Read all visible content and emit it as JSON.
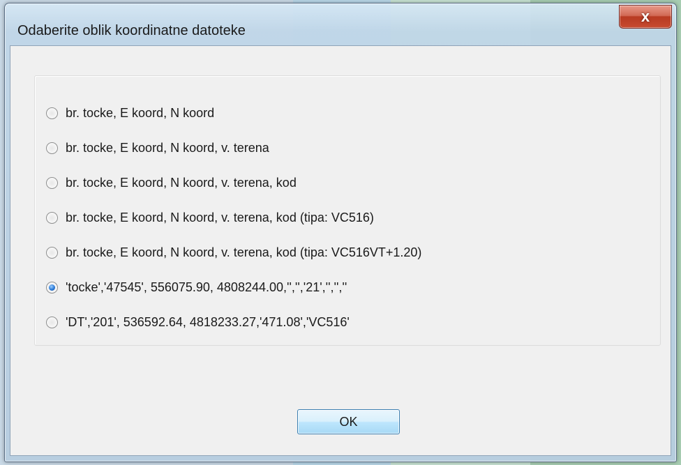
{
  "window": {
    "title": "Odaberite oblik koordinatne datoteke",
    "close_label": "x"
  },
  "options": [
    {
      "label": "br. tocke, E koord, N koord",
      "checked": false
    },
    {
      "label": "br. tocke, E koord, N koord, v. terena",
      "checked": false
    },
    {
      "label": "br. tocke, E koord, N koord, v. terena, kod",
      "checked": false
    },
    {
      "label": "br. tocke, E koord, N koord, v. terena, kod (tipa: VC516)",
      "checked": false
    },
    {
      "label": "br. tocke, E koord, N koord, v. terena, kod (tipa: VC516VT+1.20)",
      "checked": false
    },
    {
      "label": "'tocke','47545', 556075.90, 4808244.00,'','','21','','',''",
      "checked": true
    },
    {
      "label": "'DT','201', 536592.64, 4818233.27,'471.08','VC516'",
      "checked": false
    }
  ],
  "buttons": {
    "ok_label": "OK"
  }
}
